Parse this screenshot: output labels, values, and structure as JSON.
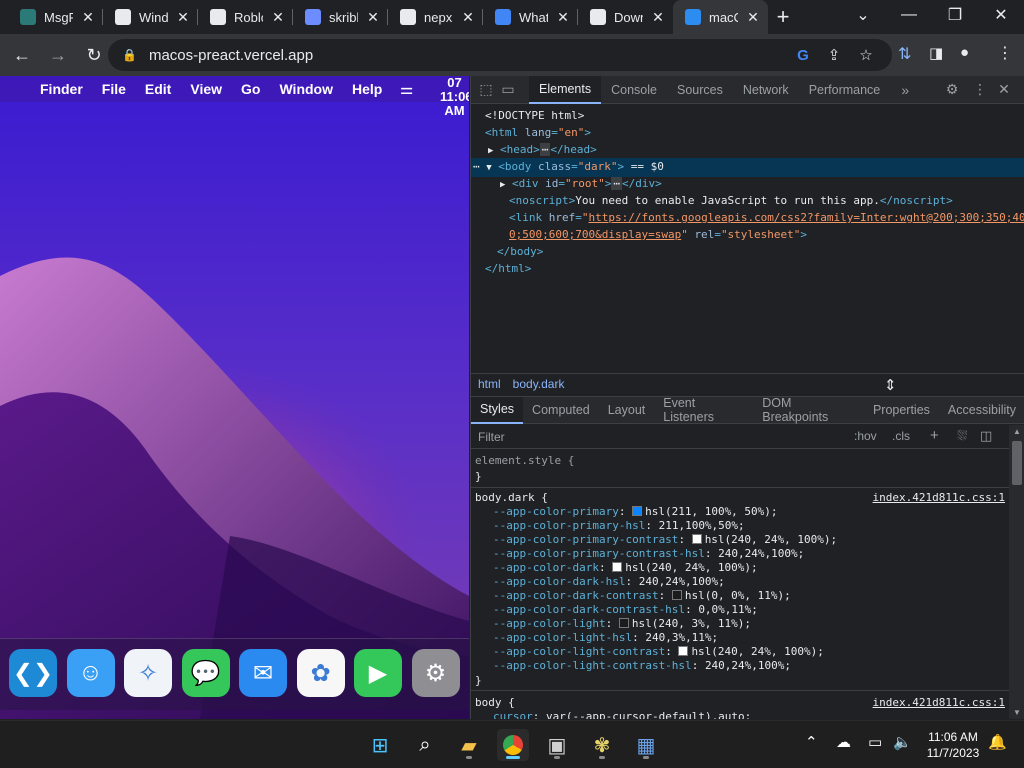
{
  "browser": {
    "tabs": [
      {
        "title": "MsgR",
        "icon": "msg-icon",
        "color": "#2b7a78"
      },
      {
        "title": "Wind",
        "icon": "bank-icon",
        "color": "#e8eaed"
      },
      {
        "title": "Roblo",
        "icon": "roblox-icon",
        "color": "#e8eaed"
      },
      {
        "title": "skribl",
        "icon": "pen-icon",
        "color": "#6c8cff"
      },
      {
        "title": "nepx.",
        "icon": "globe-icon",
        "color": "#e8eaed"
      },
      {
        "title": "What",
        "icon": "google-icon",
        "color": "#4285f4"
      },
      {
        "title": "Down",
        "icon": "download-icon",
        "color": "#e8eaed"
      },
      {
        "title": "macC",
        "icon": "finder-icon",
        "color": "#2d8cf0"
      }
    ],
    "active_tab": 7,
    "url": "macos-preact.vercel.app"
  },
  "macos": {
    "menu": [
      "Finder",
      "File",
      "Edit",
      "View",
      "Go",
      "Window",
      "Help"
    ],
    "clock_lines": [
      "07",
      "11:06",
      "AM"
    ],
    "dock": [
      {
        "name": "vscode",
        "color": "#1e8ad6",
        "glyph": "❮❯"
      },
      {
        "name": "finder",
        "color": "#3aa0f5",
        "glyph": "☺"
      },
      {
        "name": "safari",
        "color": "#f0f4f8",
        "glyph": "✧"
      },
      {
        "name": "messages",
        "color": "#35c759",
        "glyph": "💬"
      },
      {
        "name": "mail",
        "color": "#2a8af0",
        "glyph": "✉"
      },
      {
        "name": "photos",
        "color": "#f7f7f7",
        "glyph": "✿"
      },
      {
        "name": "facetime",
        "color": "#34c759",
        "glyph": "▶"
      },
      {
        "name": "settings",
        "color": "#8e8e93",
        "glyph": "⚙"
      }
    ]
  },
  "devtools": {
    "tabs": [
      "Elements",
      "Console",
      "Sources",
      "Network",
      "Performance"
    ],
    "active": "Elements",
    "dom": {
      "doctype": "<!DOCTYPE html>",
      "html_open_tag": "<html",
      "html_attr": "lang",
      "html_attr_val": "\"en\"",
      "close_bracket": ">",
      "head_text": "<head>",
      "head_close": "</head>",
      "ellipsis": "⋯",
      "body_open": "<body",
      "body_attr": "class",
      "body_attr_val": "\"dark\"",
      "body_marker": "== $0",
      "div_open": "<div",
      "div_attr": "id",
      "div_attr_val": "\"root\"",
      "div_close": "</div>",
      "noscript_open": "<noscript>",
      "noscript_text": "You need to enable JavaScript to run this app.",
      "noscript_close": "</noscript>",
      "link_open": "<link",
      "link_attr": "href",
      "link_url_1": "https://fonts.googleapis.com/css2?family=Inter:wght@200;300;350;40",
      "link_url_2": "0;500;600;700&display=swap",
      "link_rel_attr": "rel",
      "link_rel_val": "\"stylesheet\"",
      "body_close": "</body>",
      "html_close": "</html>"
    },
    "breadcrumbs": [
      "html",
      "body.dark"
    ],
    "style_tabs": [
      "Styles",
      "Computed",
      "Layout",
      "Event Listeners",
      "DOM Breakpoints",
      "Properties",
      "Accessibility"
    ],
    "filter_placeholder": "Filter",
    "hov": ":hov",
    "cls": ".cls",
    "element_style": "element.style {",
    "close_brace": "}",
    "body_dark_selector": "body.dark {",
    "source": "index.421d811c.css:1",
    "props": [
      {
        "name": "--app-color-primary",
        "value": "hsl(211, 100%, 50%);",
        "swatch": "#0a84ff"
      },
      {
        "name": "--app-color-primary-hsl",
        "value": "211,100%,50%;",
        "swatch": ""
      },
      {
        "name": "--app-color-primary-contrast",
        "value": "hsl(240, 24%, 100%);",
        "swatch": "#ffffff"
      },
      {
        "name": "--app-color-primary-contrast-hsl",
        "value": "240,24%,100%;",
        "swatch": ""
      },
      {
        "name": "--app-color-dark",
        "value": "hsl(240, 24%, 100%);",
        "swatch": "#ffffff"
      },
      {
        "name": "--app-color-dark-hsl",
        "value": "240,24%,100%;",
        "swatch": ""
      },
      {
        "name": "--app-color-dark-contrast",
        "value": "hsl(0, 0%, 11%);",
        "swatch": "#1c1c1c"
      },
      {
        "name": "--app-color-dark-contrast-hsl",
        "value": "0,0%,11%;",
        "swatch": ""
      },
      {
        "name": "--app-color-light",
        "value": "hsl(240, 3%, 11%);",
        "swatch": "#1b1b1d"
      },
      {
        "name": "--app-color-light-hsl",
        "value": "240,3%,11%;",
        "swatch": ""
      },
      {
        "name": "--app-color-light-contrast",
        "value": "hsl(240, 24%, 100%);",
        "swatch": "#ffffff"
      },
      {
        "name": "--app-color-light-contrast-hsl",
        "value": "240,24%,100%;",
        "swatch": ""
      }
    ],
    "body_selector": "body {",
    "body_cursor_prop": "cursor",
    "body_cursor_val": "var(--app-cursor-default),auto;"
  },
  "taskbar": {
    "time": "11:06 AM",
    "date": "11/7/2023"
  }
}
